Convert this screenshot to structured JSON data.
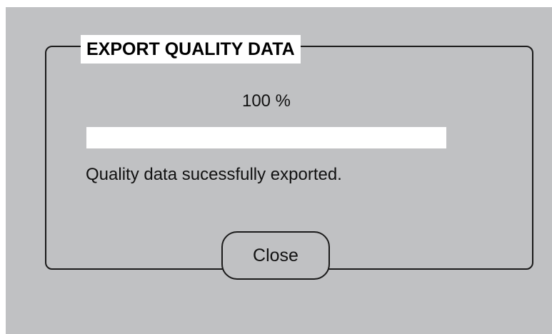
{
  "dialog": {
    "title": "EXPORT QUALITY DATA",
    "progress": {
      "percent_label": "100 %",
      "value": 1.0
    },
    "message": "Quality data sucessfully exported.",
    "close_label": "Close"
  },
  "colors": {
    "background": "#c0c1c3",
    "progress_fill": "#ffffff",
    "border": "#1a1a1a"
  }
}
